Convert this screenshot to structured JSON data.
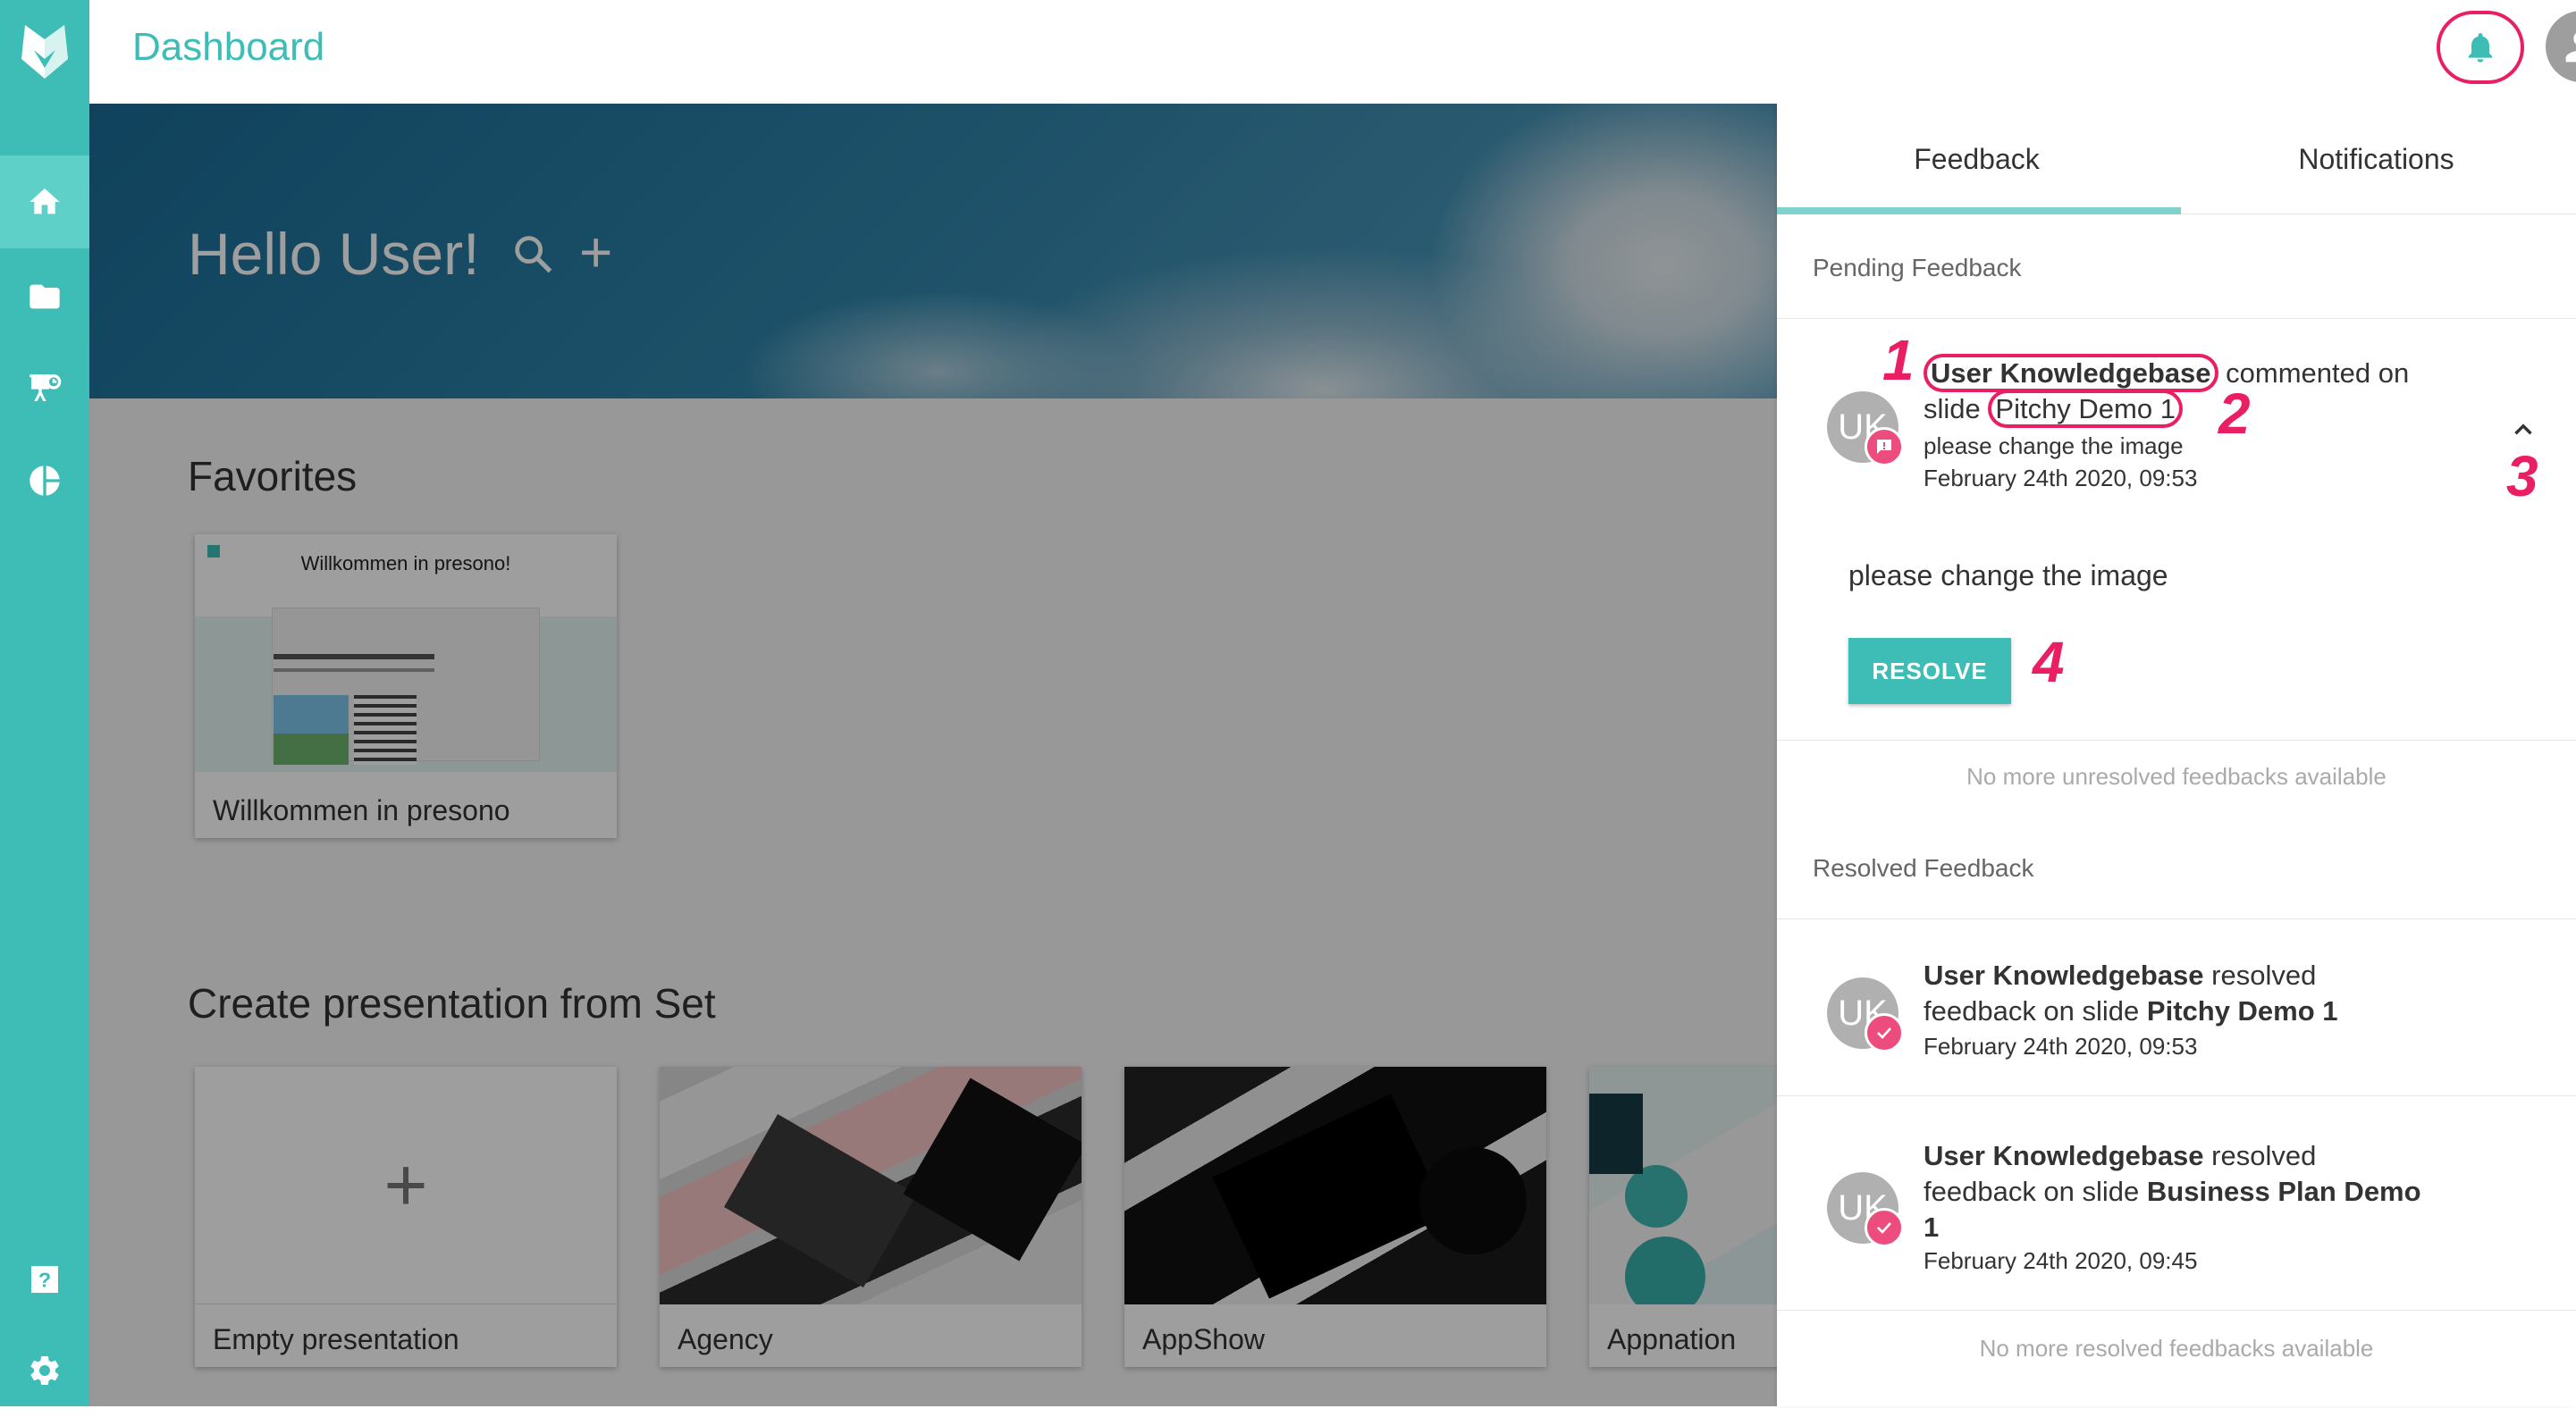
{
  "header": {
    "title": "Dashboard"
  },
  "hero": {
    "title": "Hello User!"
  },
  "favorites": {
    "title": "Favorites",
    "items": [
      {
        "label": "Willkommen in presono",
        "thumb_title": "Willkommen in presono!"
      }
    ]
  },
  "sets": {
    "title": "Create presentation from Set",
    "items": [
      {
        "label": "Empty presentation"
      },
      {
        "label": "Agency"
      },
      {
        "label": "AppShow"
      },
      {
        "label": "Appnation"
      }
    ]
  },
  "panel": {
    "tabs": [
      {
        "label": "Feedback"
      },
      {
        "label": "Notifications"
      }
    ],
    "pending": {
      "title": "Pending Feedback",
      "item": {
        "avatar": "UK",
        "user": "User Knowledgebase",
        "action": "commented on",
        "slide_prefix": "slide",
        "slide": "Pitchy Demo 1",
        "comment": "please change the image",
        "date": "February 24th 2020, 09:53",
        "detail": "please change the image",
        "resolve_label": "RESOLVE"
      },
      "empty_note": "No more unresolved feedbacks available"
    },
    "resolved": {
      "title": "Resolved Feedback",
      "items": [
        {
          "avatar": "UK",
          "user": "User Knowledgebase",
          "text1": "resolved",
          "text2": "feedback on slide",
          "slide": "Pitchy Demo 1",
          "date": "February 24th 2020, 09:53"
        },
        {
          "avatar": "UK",
          "user": "User Knowledgebase",
          "text1": "resolved",
          "text2": "feedback on slide",
          "slide": "Business Plan Demo",
          "slide2": "1",
          "date": "February 24th 2020, 09:45"
        }
      ],
      "empty_note": "No more resolved feedbacks available"
    }
  },
  "annotations": [
    "1",
    "2",
    "3",
    "4"
  ],
  "colors": {
    "accent": "#3dbdb5",
    "highlight": "#e91e63",
    "badge": "#ec4c7e"
  }
}
